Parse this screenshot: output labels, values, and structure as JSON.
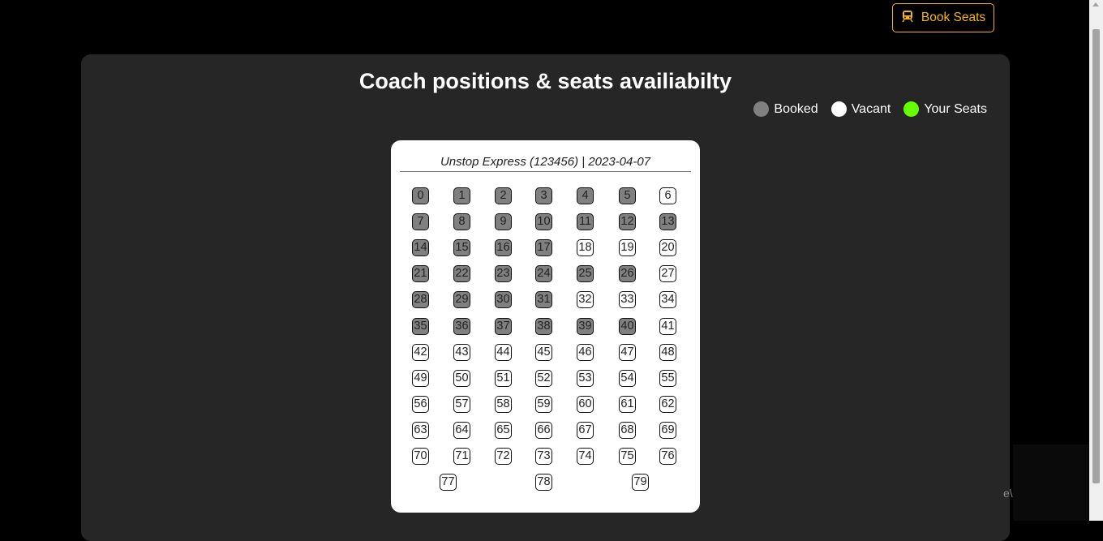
{
  "header": {
    "book_button_label": "Book Seats",
    "book_button_icon": "train-icon"
  },
  "panel": {
    "title": "Coach positions & seats availiabilty"
  },
  "legend": [
    {
      "label": "Booked",
      "color": "#808080"
    },
    {
      "label": "Vacant",
      "color": "#ffffff"
    },
    {
      "label": "Your Seats",
      "color": "#66ff00"
    }
  ],
  "coach": {
    "header": "Unstop Express (123456) | 2023-04-07",
    "booked_seats": [
      0,
      1,
      2,
      3,
      4,
      5,
      7,
      8,
      9,
      10,
      11,
      12,
      13,
      14,
      15,
      16,
      17,
      21,
      22,
      23,
      24,
      25,
      26,
      28,
      29,
      30,
      31,
      35,
      36,
      37,
      38,
      39,
      40
    ],
    "seats": [
      0,
      1,
      2,
      3,
      4,
      5,
      6,
      7,
      8,
      9,
      10,
      11,
      12,
      13,
      14,
      15,
      16,
      17,
      18,
      19,
      20,
      21,
      22,
      23,
      24,
      25,
      26,
      27,
      28,
      29,
      30,
      31,
      32,
      33,
      34,
      35,
      36,
      37,
      38,
      39,
      40,
      41,
      42,
      43,
      44,
      45,
      46,
      47,
      48,
      49,
      50,
      51,
      52,
      53,
      54,
      55,
      56,
      57,
      58,
      59,
      60,
      61,
      62,
      63,
      64,
      65,
      66,
      67,
      68,
      69,
      70,
      71,
      72,
      73,
      74,
      75,
      76,
      77,
      78,
      79
    ]
  },
  "chat_widget": {
    "text": "e\\"
  },
  "colors": {
    "accent": "#f5b50a",
    "panel": "#262626",
    "booked": "#808080",
    "vacant": "#ffffff",
    "yours": "#66ff00"
  }
}
